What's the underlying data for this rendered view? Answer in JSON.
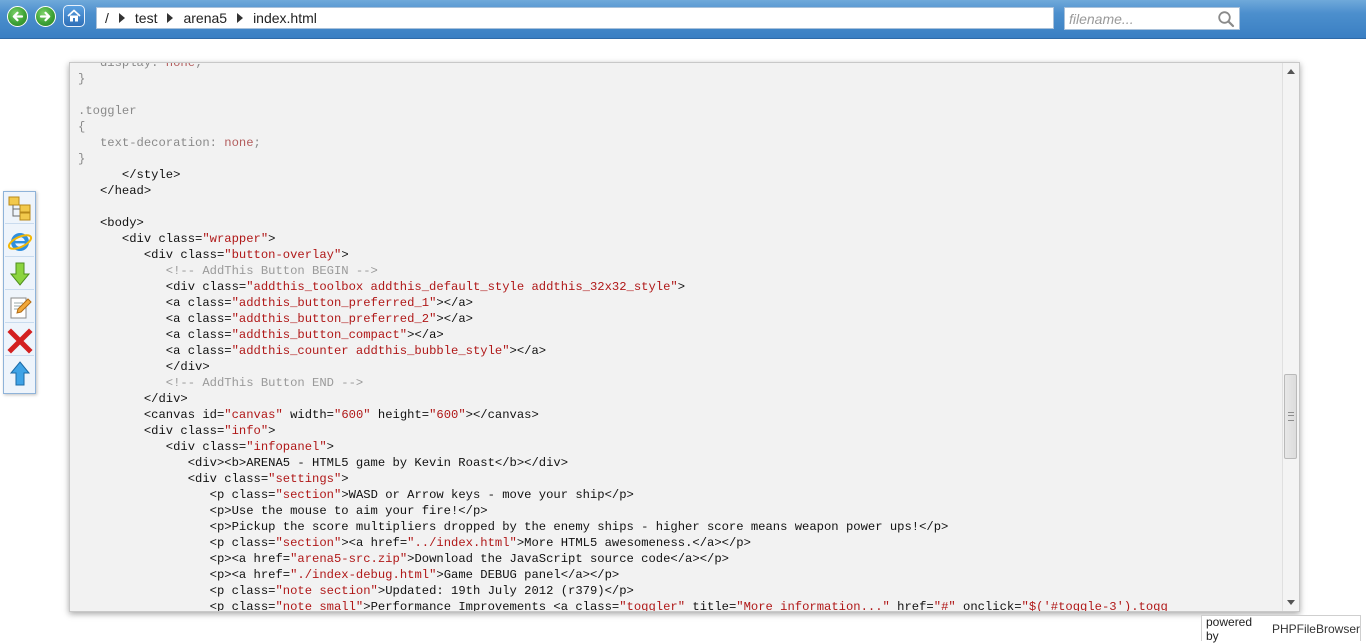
{
  "toolbar": {
    "back_icon": "back-arrow-icon",
    "forward_icon": "forward-arrow-icon",
    "home_icon": "home-icon",
    "path": {
      "root": "/",
      "segments": [
        "test",
        "arena5",
        "index.html"
      ]
    },
    "search": {
      "placeholder": "filename...",
      "value": "",
      "icon": "search-icon"
    }
  },
  "sidebar_tools": [
    "folder-tree-icon",
    "internet-explorer-icon",
    "download-icon",
    "edit-icon",
    "delete-icon",
    "upload-icon"
  ],
  "code_lines": [
    {
      "parts": [
        {
          "t": "   display: ",
          "c": "css"
        },
        {
          "t": "none",
          "c": "val"
        },
        {
          "t": ";",
          "c": "css"
        }
      ]
    },
    {
      "parts": [
        {
          "t": "}",
          "c": "css"
        }
      ]
    },
    {
      "parts": [
        {
          "t": "",
          "c": "css"
        }
      ]
    },
    {
      "parts": [
        {
          "t": ".toggler",
          "c": "css"
        }
      ]
    },
    {
      "parts": [
        {
          "t": "{",
          "c": "css"
        }
      ]
    },
    {
      "parts": [
        {
          "t": "   text-decoration: ",
          "c": "css"
        },
        {
          "t": "none",
          "c": "val"
        },
        {
          "t": ";",
          "c": "css"
        }
      ]
    },
    {
      "parts": [
        {
          "t": "}",
          "c": "css"
        }
      ]
    },
    {
      "parts": [
        {
          "t": "      </style>",
          "c": "tag"
        }
      ]
    },
    {
      "parts": [
        {
          "t": "   </head>",
          "c": "tag"
        }
      ]
    },
    {
      "parts": [
        {
          "t": "",
          "c": "tag"
        }
      ]
    },
    {
      "parts": [
        {
          "t": "   <body>",
          "c": "tag"
        }
      ]
    },
    {
      "parts": [
        {
          "t": "      <div class=",
          "c": "tag"
        },
        {
          "t": "\"wrapper\"",
          "c": "str"
        },
        {
          "t": ">",
          "c": "tag"
        }
      ]
    },
    {
      "parts": [
        {
          "t": "         <div class=",
          "c": "tag"
        },
        {
          "t": "\"button-overlay\"",
          "c": "str"
        },
        {
          "t": ">",
          "c": "tag"
        }
      ]
    },
    {
      "parts": [
        {
          "t": "            <!-- AddThis Button BEGIN -->",
          "c": "com"
        }
      ]
    },
    {
      "parts": [
        {
          "t": "            <div class=",
          "c": "tag"
        },
        {
          "t": "\"addthis_toolbox addthis_default_style addthis_32x32_style\"",
          "c": "str"
        },
        {
          "t": ">",
          "c": "tag"
        }
      ]
    },
    {
      "parts": [
        {
          "t": "            <a class=",
          "c": "tag"
        },
        {
          "t": "\"addthis_button_preferred_1\"",
          "c": "str"
        },
        {
          "t": "></a>",
          "c": "tag"
        }
      ]
    },
    {
      "parts": [
        {
          "t": "            <a class=",
          "c": "tag"
        },
        {
          "t": "\"addthis_button_preferred_2\"",
          "c": "str"
        },
        {
          "t": "></a>",
          "c": "tag"
        }
      ]
    },
    {
      "parts": [
        {
          "t": "            <a class=",
          "c": "tag"
        },
        {
          "t": "\"addthis_button_compact\"",
          "c": "str"
        },
        {
          "t": "></a>",
          "c": "tag"
        }
      ]
    },
    {
      "parts": [
        {
          "t": "            <a class=",
          "c": "tag"
        },
        {
          "t": "\"addthis_counter addthis_bubble_style\"",
          "c": "str"
        },
        {
          "t": "></a>",
          "c": "tag"
        }
      ]
    },
    {
      "parts": [
        {
          "t": "            </div>",
          "c": "tag"
        }
      ]
    },
    {
      "parts": [
        {
          "t": "            <!-- AddThis Button END -->",
          "c": "com"
        }
      ]
    },
    {
      "parts": [
        {
          "t": "         </div>",
          "c": "tag"
        }
      ]
    },
    {
      "parts": [
        {
          "t": "         <canvas id=",
          "c": "tag"
        },
        {
          "t": "\"canvas\"",
          "c": "str"
        },
        {
          "t": " width=",
          "c": "tag"
        },
        {
          "t": "\"600\"",
          "c": "str"
        },
        {
          "t": " height=",
          "c": "tag"
        },
        {
          "t": "\"600\"",
          "c": "str"
        },
        {
          "t": "></canvas>",
          "c": "tag"
        }
      ]
    },
    {
      "parts": [
        {
          "t": "         <div class=",
          "c": "tag"
        },
        {
          "t": "\"info\"",
          "c": "str"
        },
        {
          "t": ">",
          "c": "tag"
        }
      ]
    },
    {
      "parts": [
        {
          "t": "            <div class=",
          "c": "tag"
        },
        {
          "t": "\"infopanel\"",
          "c": "str"
        },
        {
          "t": ">",
          "c": "tag"
        }
      ]
    },
    {
      "parts": [
        {
          "t": "               <div><b>ARENA5 - HTML5 game by Kevin Roast</b></div>",
          "c": "tag"
        }
      ]
    },
    {
      "parts": [
        {
          "t": "               <div class=",
          "c": "tag"
        },
        {
          "t": "\"settings\"",
          "c": "str"
        },
        {
          "t": ">",
          "c": "tag"
        }
      ]
    },
    {
      "parts": [
        {
          "t": "                  <p class=",
          "c": "tag"
        },
        {
          "t": "\"section\"",
          "c": "str"
        },
        {
          "t": ">WASD or Arrow keys - move your ship</p>",
          "c": "tag"
        }
      ]
    },
    {
      "parts": [
        {
          "t": "                  <p>Use the mouse to aim your fire!</p>",
          "c": "tag"
        }
      ]
    },
    {
      "parts": [
        {
          "t": "                  <p>Pickup the score multipliers dropped by the enemy ships - higher score means weapon power ups!</p>",
          "c": "tag"
        }
      ]
    },
    {
      "parts": [
        {
          "t": "                  <p class=",
          "c": "tag"
        },
        {
          "t": "\"section\"",
          "c": "str"
        },
        {
          "t": "><a href=",
          "c": "tag"
        },
        {
          "t": "\"../index.html\"",
          "c": "str"
        },
        {
          "t": ">More HTML5 awesomeness.</a></p>",
          "c": "tag"
        }
      ]
    },
    {
      "parts": [
        {
          "t": "                  <p><a href=",
          "c": "tag"
        },
        {
          "t": "\"arena5-src.zip\"",
          "c": "str"
        },
        {
          "t": ">Download the JavaScript source code</a></p>",
          "c": "tag"
        }
      ]
    },
    {
      "parts": [
        {
          "t": "                  <p><a href=",
          "c": "tag"
        },
        {
          "t": "\"./index-debug.html\"",
          "c": "str"
        },
        {
          "t": ">Game DEBUG panel</a></p>",
          "c": "tag"
        }
      ]
    },
    {
      "parts": [
        {
          "t": "                  <p class=",
          "c": "tag"
        },
        {
          "t": "\"note section\"",
          "c": "str"
        },
        {
          "t": ">Updated: 19th July 2012 (r379)</p>",
          "c": "tag"
        }
      ]
    },
    {
      "parts": [
        {
          "t": "                  <p class=",
          "c": "tag"
        },
        {
          "t": "\"note small\"",
          "c": "str"
        },
        {
          "t": ">Performance Improvements <a class=",
          "c": "tag"
        },
        {
          "t": "\"toggler\"",
          "c": "str"
        },
        {
          "t": " title=",
          "c": "tag"
        },
        {
          "t": "\"More information...\"",
          "c": "str"
        },
        {
          "t": " href=",
          "c": "tag"
        },
        {
          "t": "\"#\"",
          "c": "str"
        },
        {
          "t": " onclick=",
          "c": "tag"
        },
        {
          "t": "\"$('#toggle-3').togg",
          "c": "str"
        }
      ]
    }
  ],
  "footer": {
    "powered_label": "powered by",
    "brand": "PHPFileBrowser"
  }
}
